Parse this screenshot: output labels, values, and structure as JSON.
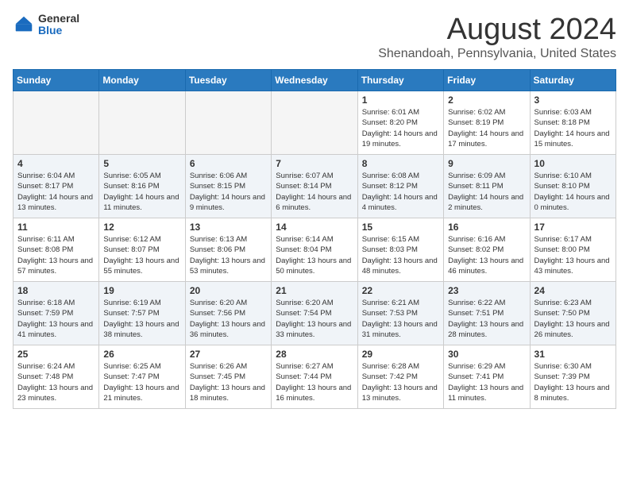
{
  "logo": {
    "general": "General",
    "blue": "Blue"
  },
  "title": {
    "month_year": "August 2024",
    "location": "Shenandoah, Pennsylvania, United States"
  },
  "headers": [
    "Sunday",
    "Monday",
    "Tuesday",
    "Wednesday",
    "Thursday",
    "Friday",
    "Saturday"
  ],
  "weeks": [
    [
      {
        "day": "",
        "empty": true
      },
      {
        "day": "",
        "empty": true
      },
      {
        "day": "",
        "empty": true
      },
      {
        "day": "",
        "empty": true
      },
      {
        "day": "1",
        "sunrise": "6:01 AM",
        "sunset": "8:20 PM",
        "daylight": "14 hours and 19 minutes."
      },
      {
        "day": "2",
        "sunrise": "6:02 AM",
        "sunset": "8:19 PM",
        "daylight": "14 hours and 17 minutes."
      },
      {
        "day": "3",
        "sunrise": "6:03 AM",
        "sunset": "8:18 PM",
        "daylight": "14 hours and 15 minutes."
      }
    ],
    [
      {
        "day": "4",
        "sunrise": "6:04 AM",
        "sunset": "8:17 PM",
        "daylight": "14 hours and 13 minutes."
      },
      {
        "day": "5",
        "sunrise": "6:05 AM",
        "sunset": "8:16 PM",
        "daylight": "14 hours and 11 minutes."
      },
      {
        "day": "6",
        "sunrise": "6:06 AM",
        "sunset": "8:15 PM",
        "daylight": "14 hours and 9 minutes."
      },
      {
        "day": "7",
        "sunrise": "6:07 AM",
        "sunset": "8:14 PM",
        "daylight": "14 hours and 6 minutes."
      },
      {
        "day": "8",
        "sunrise": "6:08 AM",
        "sunset": "8:12 PM",
        "daylight": "14 hours and 4 minutes."
      },
      {
        "day": "9",
        "sunrise": "6:09 AM",
        "sunset": "8:11 PM",
        "daylight": "14 hours and 2 minutes."
      },
      {
        "day": "10",
        "sunrise": "6:10 AM",
        "sunset": "8:10 PM",
        "daylight": "14 hours and 0 minutes."
      }
    ],
    [
      {
        "day": "11",
        "sunrise": "6:11 AM",
        "sunset": "8:08 PM",
        "daylight": "13 hours and 57 minutes."
      },
      {
        "day": "12",
        "sunrise": "6:12 AM",
        "sunset": "8:07 PM",
        "daylight": "13 hours and 55 minutes."
      },
      {
        "day": "13",
        "sunrise": "6:13 AM",
        "sunset": "8:06 PM",
        "daylight": "13 hours and 53 minutes."
      },
      {
        "day": "14",
        "sunrise": "6:14 AM",
        "sunset": "8:04 PM",
        "daylight": "13 hours and 50 minutes."
      },
      {
        "day": "15",
        "sunrise": "6:15 AM",
        "sunset": "8:03 PM",
        "daylight": "13 hours and 48 minutes."
      },
      {
        "day": "16",
        "sunrise": "6:16 AM",
        "sunset": "8:02 PM",
        "daylight": "13 hours and 46 minutes."
      },
      {
        "day": "17",
        "sunrise": "6:17 AM",
        "sunset": "8:00 PM",
        "daylight": "13 hours and 43 minutes."
      }
    ],
    [
      {
        "day": "18",
        "sunrise": "6:18 AM",
        "sunset": "7:59 PM",
        "daylight": "13 hours and 41 minutes."
      },
      {
        "day": "19",
        "sunrise": "6:19 AM",
        "sunset": "7:57 PM",
        "daylight": "13 hours and 38 minutes."
      },
      {
        "day": "20",
        "sunrise": "6:20 AM",
        "sunset": "7:56 PM",
        "daylight": "13 hours and 36 minutes."
      },
      {
        "day": "21",
        "sunrise": "6:20 AM",
        "sunset": "7:54 PM",
        "daylight": "13 hours and 33 minutes."
      },
      {
        "day": "22",
        "sunrise": "6:21 AM",
        "sunset": "7:53 PM",
        "daylight": "13 hours and 31 minutes."
      },
      {
        "day": "23",
        "sunrise": "6:22 AM",
        "sunset": "7:51 PM",
        "daylight": "13 hours and 28 minutes."
      },
      {
        "day": "24",
        "sunrise": "6:23 AM",
        "sunset": "7:50 PM",
        "daylight": "13 hours and 26 minutes."
      }
    ],
    [
      {
        "day": "25",
        "sunrise": "6:24 AM",
        "sunset": "7:48 PM",
        "daylight": "13 hours and 23 minutes."
      },
      {
        "day": "26",
        "sunrise": "6:25 AM",
        "sunset": "7:47 PM",
        "daylight": "13 hours and 21 minutes."
      },
      {
        "day": "27",
        "sunrise": "6:26 AM",
        "sunset": "7:45 PM",
        "daylight": "13 hours and 18 minutes."
      },
      {
        "day": "28",
        "sunrise": "6:27 AM",
        "sunset": "7:44 PM",
        "daylight": "13 hours and 16 minutes."
      },
      {
        "day": "29",
        "sunrise": "6:28 AM",
        "sunset": "7:42 PM",
        "daylight": "13 hours and 13 minutes."
      },
      {
        "day": "30",
        "sunrise": "6:29 AM",
        "sunset": "7:41 PM",
        "daylight": "13 hours and 11 minutes."
      },
      {
        "day": "31",
        "sunrise": "6:30 AM",
        "sunset": "7:39 PM",
        "daylight": "13 hours and 8 minutes."
      }
    ]
  ],
  "daylight_label": "Daylight:",
  "sunrise_label": "Sunrise:",
  "sunset_label": "Sunset:"
}
